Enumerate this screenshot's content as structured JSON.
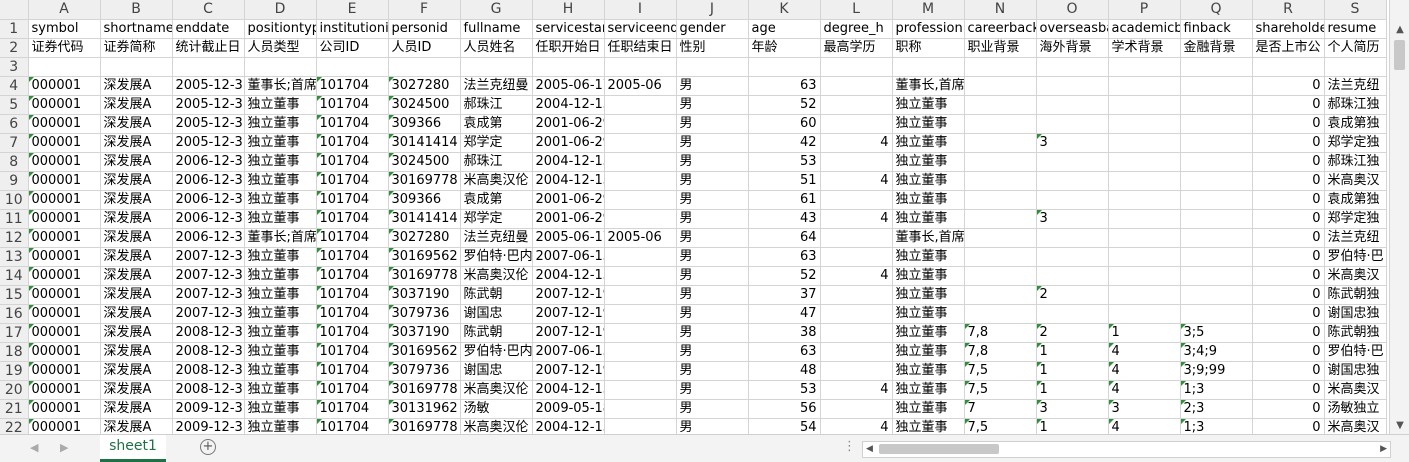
{
  "columns": [
    "A",
    "B",
    "C",
    "D",
    "E",
    "F",
    "G",
    "H",
    "I",
    "J",
    "K",
    "L",
    "M",
    "N",
    "O",
    "P",
    "Q",
    "R",
    "S"
  ],
  "col_widths": [],
  "rows": [
    {
      "n": "1",
      "cells": [
        "symbol",
        "shortname",
        "enddate",
        "positiontype",
        "institutionid",
        "personid",
        "fullname",
        "servicestart",
        "serviceend",
        "gender",
        "age",
        "degree_h",
        "profession",
        "careerback",
        "overseasba",
        "academicb",
        "finback",
        "shareholde",
        "resume"
      ]
    },
    {
      "n": "2",
      "cells": [
        "证券代码",
        "证券简称",
        "统计截止日",
        "人员类型",
        "公司ID",
        "人员ID",
        "人员姓名",
        "任职开始日",
        "任职结束日",
        "性别",
        "年龄",
        "最高学历",
        "职称",
        "职业背景",
        "海外背景",
        "学术背景",
        "金融背景",
        "是否上市公",
        "个人简历"
      ]
    },
    {
      "n": "3",
      "cells": [
        "",
        "",
        "",
        "",
        "",
        "",
        "",
        "",
        "",
        "",
        "",
        "",
        "",
        "",
        "",
        "",
        "",
        "",
        ""
      ]
    },
    {
      "n": "4",
      "cells": [
        "000001",
        "深发展A",
        "2005-12-31",
        "董事长;首席",
        "101704",
        "3027280",
        "法兰克纽曼",
        "2005-06-17",
        "2005-06",
        "男",
        "63",
        "",
        "董事长,首席执行官",
        "",
        "",
        "",
        "",
        "0",
        "法兰克纽"
      ]
    },
    {
      "n": "5",
      "cells": [
        "000001",
        "深发展A",
        "2005-12-31",
        "独立董事",
        "101704",
        "3024500",
        "郝珠江",
        "2004-12-13",
        "",
        "男",
        "52",
        "",
        "独立董事",
        "",
        "",
        "",
        "",
        "0",
        "郝珠江独"
      ]
    },
    {
      "n": "6",
      "cells": [
        "000001",
        "深发展A",
        "2005-12-31",
        "独立董事",
        "101704",
        "309366",
        "袁成第",
        "2001-06-29",
        "",
        "男",
        "60",
        "",
        "独立董事",
        "",
        "",
        "",
        "",
        "0",
        "袁成第独"
      ]
    },
    {
      "n": "7",
      "cells": [
        "000001",
        "深发展A",
        "2005-12-31",
        "独立董事",
        "101704",
        "30141414",
        "郑学定",
        "2001-06-29",
        "",
        "男",
        "42",
        "4",
        "独立董事",
        "",
        "3",
        "",
        "",
        "0",
        "郑学定独"
      ]
    },
    {
      "n": "8",
      "cells": [
        "000001",
        "深发展A",
        "2006-12-31",
        "独立董事",
        "101704",
        "3024500",
        "郝珠江",
        "2004-12-13",
        "",
        "男",
        "53",
        "",
        "独立董事",
        "",
        "",
        "",
        "",
        "0",
        "郝珠江独"
      ]
    },
    {
      "n": "9",
      "cells": [
        "000001",
        "深发展A",
        "2006-12-31",
        "独立董事",
        "101704",
        "30169778",
        "米高奥汉伦",
        "2004-12-13",
        "",
        "男",
        "51",
        "4",
        "独立董事",
        "",
        "",
        "",
        "",
        "0",
        "米高奥汉"
      ]
    },
    {
      "n": "10",
      "cells": [
        "000001",
        "深发展A",
        "2006-12-31",
        "独立董事",
        "101704",
        "309366",
        "袁成第",
        "2001-06-29",
        "",
        "男",
        "61",
        "",
        "独立董事",
        "",
        "",
        "",
        "",
        "0",
        "袁成第独"
      ]
    },
    {
      "n": "11",
      "cells": [
        "000001",
        "深发展A",
        "2006-12-31",
        "独立董事",
        "101704",
        "30141414",
        "郑学定",
        "2001-06-29",
        "",
        "男",
        "43",
        "4",
        "独立董事",
        "",
        "3",
        "",
        "",
        "0",
        "郑学定独"
      ]
    },
    {
      "n": "12",
      "cells": [
        "000001",
        "深发展A",
        "2006-12-31",
        "董事长;首席",
        "101704",
        "3027280",
        "法兰克纽曼",
        "2005-06-17",
        "2005-06",
        "男",
        "64",
        "",
        "董事长,首席执行官",
        "",
        "",
        "",
        "",
        "0",
        "法兰克纽"
      ]
    },
    {
      "n": "13",
      "cells": [
        "000001",
        "深发展A",
        "2007-12-31",
        "独立董事",
        "101704",
        "30169562",
        "罗伯特·巴内",
        "2007-06-15",
        "",
        "男",
        "63",
        "",
        "独立董事",
        "",
        "",
        "",
        "",
        "0",
        "罗伯特·巴"
      ]
    },
    {
      "n": "14",
      "cells": [
        "000001",
        "深发展A",
        "2007-12-31",
        "独立董事",
        "101704",
        "30169778",
        "米高奥汉伦",
        "2004-12-13",
        "",
        "男",
        "52",
        "4",
        "独立董事",
        "",
        "",
        "",
        "",
        "0",
        "米高奥汉"
      ]
    },
    {
      "n": "15",
      "cells": [
        "000001",
        "深发展A",
        "2007-12-31",
        "独立董事",
        "101704",
        "3037190",
        "陈武朝",
        "2007-12-19",
        "",
        "男",
        "37",
        "",
        "独立董事",
        "",
        "2",
        "",
        "",
        "0",
        "陈武朝独"
      ]
    },
    {
      "n": "16",
      "cells": [
        "000001",
        "深发展A",
        "2007-12-31",
        "独立董事",
        "101704",
        "3079736",
        "谢国忠",
        "2007-12-19",
        "",
        "男",
        "47",
        "",
        "独立董事",
        "",
        "",
        "",
        "",
        "0",
        "谢国忠独"
      ]
    },
    {
      "n": "17",
      "cells": [
        "000001",
        "深发展A",
        "2008-12-31",
        "独立董事",
        "101704",
        "3037190",
        "陈武朝",
        "2007-12-19",
        "",
        "男",
        "38",
        "",
        "独立董事",
        "7,8",
        "2",
        "1",
        "3;5",
        "0",
        "陈武朝独"
      ]
    },
    {
      "n": "18",
      "cells": [
        "000001",
        "深发展A",
        "2008-12-31",
        "独立董事",
        "101704",
        "30169562",
        "罗伯特·巴内",
        "2007-06-15",
        "",
        "男",
        "63",
        "",
        "独立董事",
        "7,8",
        "1",
        "4",
        "3;4;9",
        "0",
        "罗伯特·巴"
      ]
    },
    {
      "n": "19",
      "cells": [
        "000001",
        "深发展A",
        "2008-12-31",
        "独立董事",
        "101704",
        "3079736",
        "谢国忠",
        "2007-12-19",
        "",
        "男",
        "48",
        "",
        "独立董事",
        "7,5",
        "1",
        "4",
        "3;9;99",
        "0",
        "谢国忠独"
      ]
    },
    {
      "n": "20",
      "cells": [
        "000001",
        "深发展A",
        "2008-12-31",
        "独立董事",
        "101704",
        "30169778",
        "米高奥汉伦",
        "2004-12-13",
        "",
        "男",
        "53",
        "4",
        "独立董事",
        "7,5",
        "1",
        "4",
        "1;3",
        "0",
        "米高奥汉"
      ]
    },
    {
      "n": "21",
      "cells": [
        "000001",
        "深发展A",
        "2009-12-31",
        "独立董事",
        "101704",
        "30131962",
        "汤敏",
        "2009-05-18",
        "",
        "男",
        "56",
        "",
        "独立董事",
        "7",
        "3",
        "3",
        "2;3",
        "0",
        "汤敏独立"
      ]
    },
    {
      "n": "22",
      "cells": [
        "000001",
        "深发展A",
        "2009-12-31",
        "独立董事",
        "101704",
        "30169778",
        "米高奥汉伦",
        "2004-12-13",
        "",
        "男",
        "54",
        "4",
        "独立董事",
        "7,5",
        "1",
        "4",
        "1;3",
        "0",
        "米高奥汉"
      ]
    }
  ],
  "sheet_tab": "sheet1",
  "add_sheet_icon": "plus-circle-icon",
  "accent_color": "#1e7145",
  "triangle_color": "#2f8f3a"
}
